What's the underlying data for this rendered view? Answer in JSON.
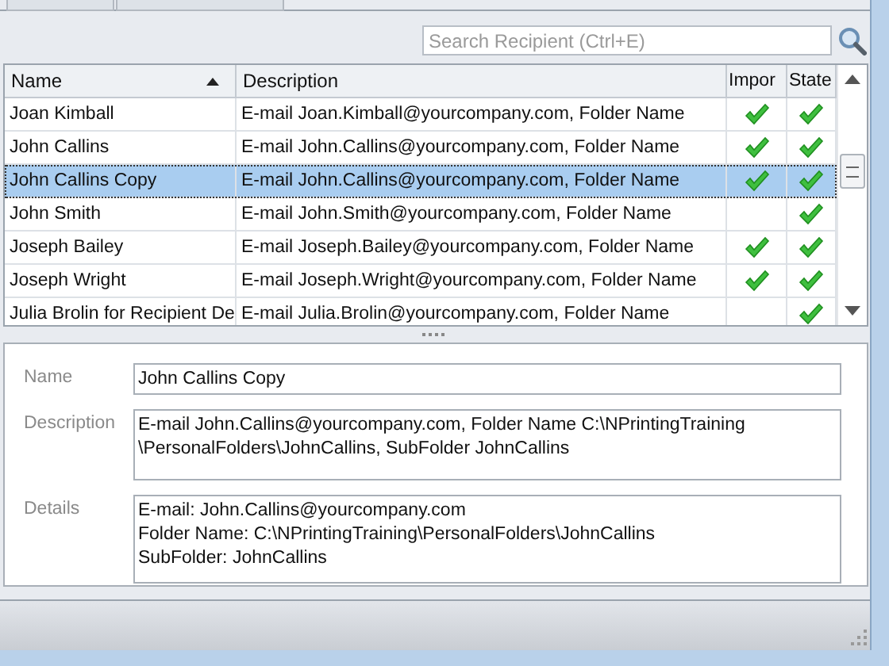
{
  "tabs": [
    {
      "selected": false
    },
    {
      "selected": false
    }
  ],
  "search": {
    "placeholder": "Search Recipient (Ctrl+E)"
  },
  "table": {
    "columns": [
      {
        "label": "Name",
        "sorted": true
      },
      {
        "label": "Description",
        "sorted": false
      },
      {
        "label": "Impor"
      },
      {
        "label": "State"
      }
    ],
    "rows": [
      {
        "name": "Joan Kimball",
        "description": "E-mail Joan.Kimball@yourcompany.com, Folder Name",
        "imported": true,
        "state": true,
        "selected": false
      },
      {
        "name": "John Callins",
        "description": "E-mail John.Callins@yourcompany.com, Folder Name",
        "imported": true,
        "state": true,
        "selected": false
      },
      {
        "name": "John Callins Copy",
        "description": "E-mail John.Callins@yourcompany.com, Folder Name",
        "imported": true,
        "state": true,
        "selected": true
      },
      {
        "name": "John Smith",
        "description": "E-mail John.Smith@yourcompany.com, Folder Name",
        "imported": false,
        "state": true,
        "selected": false
      },
      {
        "name": "Joseph Bailey",
        "description": "E-mail Joseph.Bailey@yourcompany.com, Folder Name",
        "imported": true,
        "state": true,
        "selected": false
      },
      {
        "name": "Joseph Wright",
        "description": "E-mail Joseph.Wright@yourcompany.com, Folder Name",
        "imported": true,
        "state": true,
        "selected": false
      },
      {
        "name": "Julia Brolin for Recipient De",
        "description": "E-mail Julia.Brolin@yourcompany.com, Folder Name",
        "imported": false,
        "state": true,
        "selected": false
      }
    ]
  },
  "details": [
    {
      "label": "Name",
      "lines": [
        "John Callins Copy"
      ],
      "kind": "single"
    },
    {
      "label": "Description",
      "lines": [
        "E-mail John.Callins@yourcompany.com, Folder Name C:\\NPrintingTraining",
        "\\PersonalFolders\\JohnCallins, SubFolder JohnCallins"
      ],
      "kind": "multi"
    },
    {
      "label": "Details",
      "lines": [
        "E-mail: John.Callins@yourcompany.com",
        "Folder Name: C:\\NPrintingTraining\\PersonalFolders\\JohnCallins",
        "SubFolder: JohnCallins"
      ],
      "kind": "multi"
    }
  ]
}
